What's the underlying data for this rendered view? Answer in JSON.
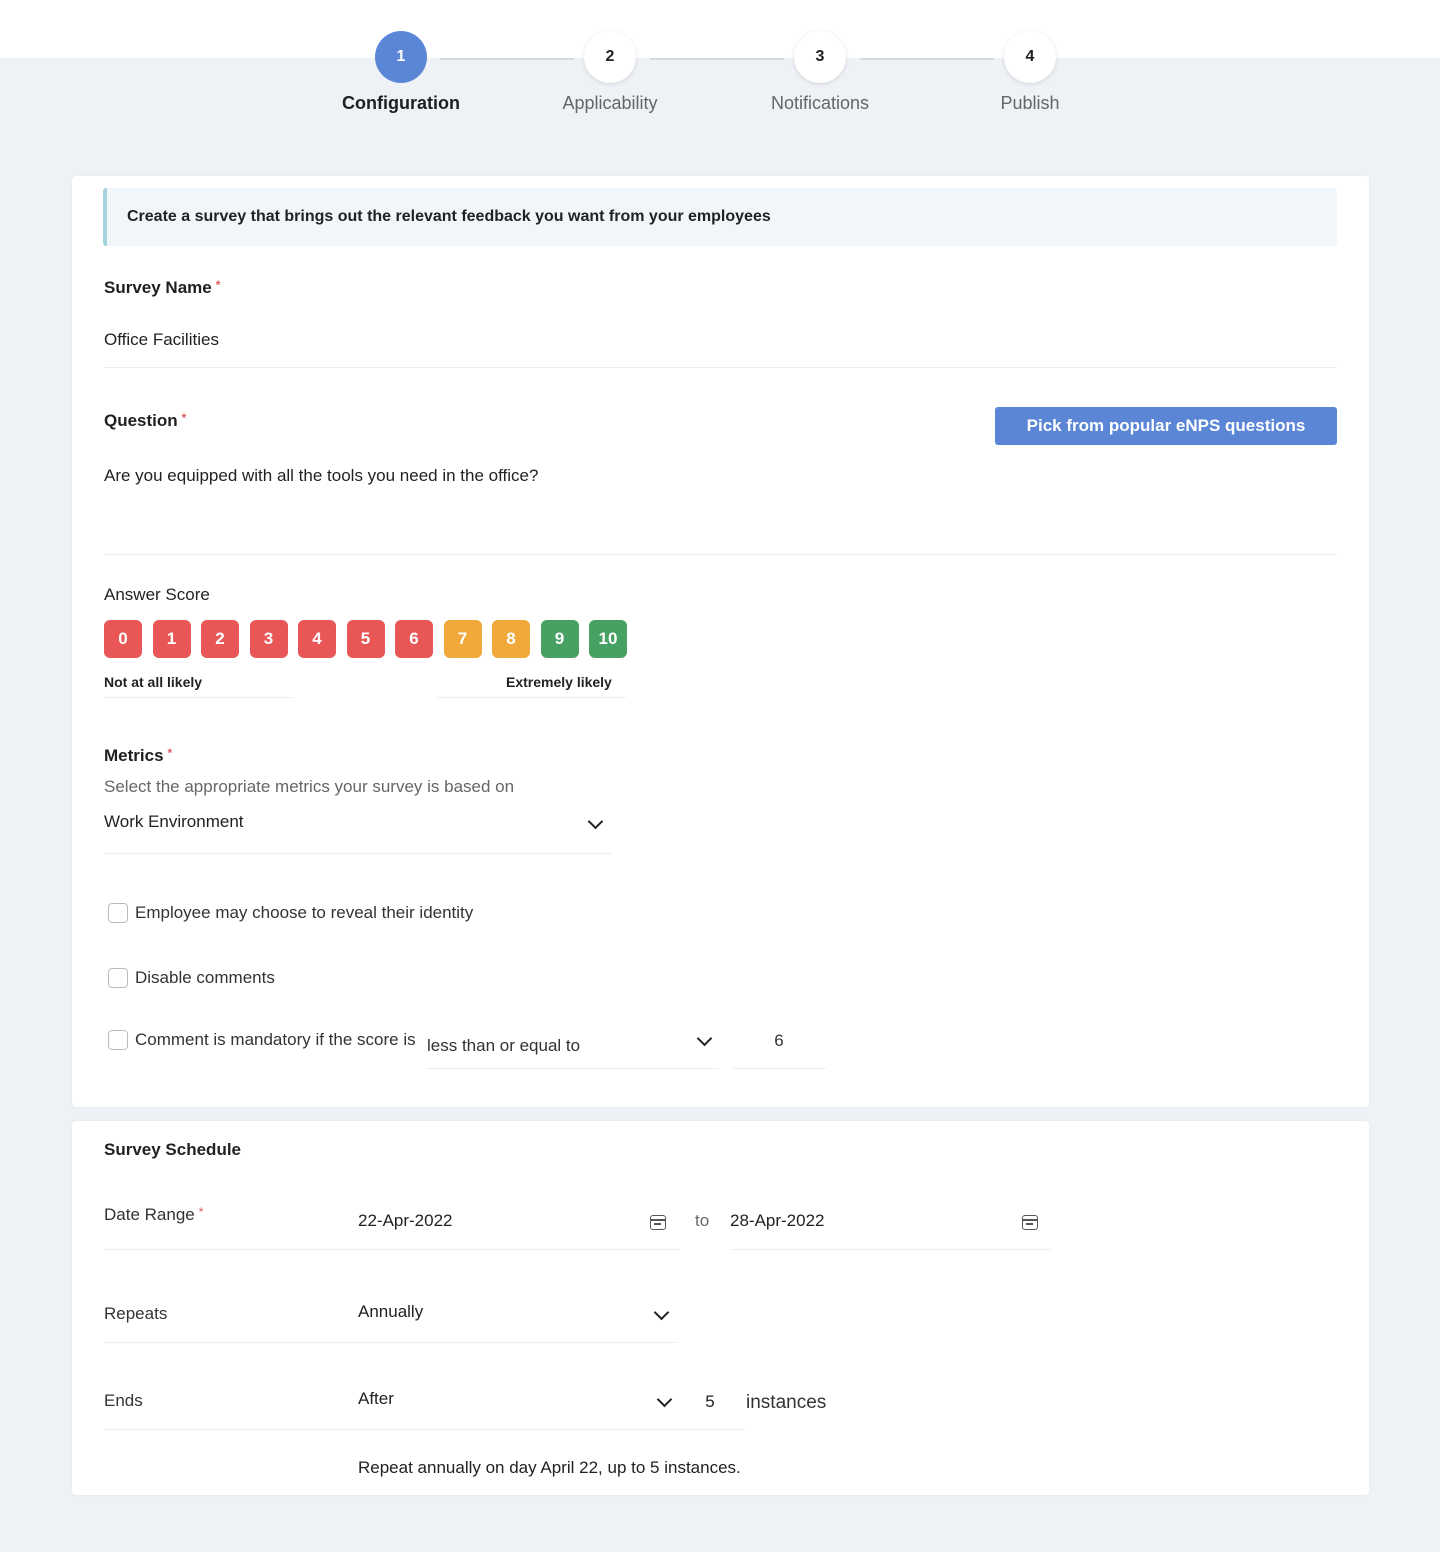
{
  "stepper": {
    "steps": [
      {
        "number": "1",
        "label": "Configuration",
        "active": true
      },
      {
        "number": "2",
        "label": "Applicability",
        "active": false
      },
      {
        "number": "3",
        "label": "Notifications",
        "active": false
      },
      {
        "number": "4",
        "label": "Publish",
        "active": false
      }
    ]
  },
  "config": {
    "banner": "Create a survey that brings out the relevant feedback you want from your employees",
    "survey_name": {
      "label": "Survey Name",
      "required_mark": "*",
      "value": "Office Facilities"
    },
    "question": {
      "label": "Question",
      "required_mark": "*",
      "value": "Are you equipped with all the tools you need in the office?",
      "pick_button": "Pick from popular eNPS questions"
    },
    "answer_score": {
      "label": "Answer Score",
      "scores": [
        {
          "value": "0",
          "category": "detractor"
        },
        {
          "value": "1",
          "category": "detractor"
        },
        {
          "value": "2",
          "category": "detractor"
        },
        {
          "value": "3",
          "category": "detractor"
        },
        {
          "value": "4",
          "category": "detractor"
        },
        {
          "value": "5",
          "category": "detractor"
        },
        {
          "value": "6",
          "category": "detractor"
        },
        {
          "value": "7",
          "category": "passive"
        },
        {
          "value": "8",
          "category": "passive"
        },
        {
          "value": "9",
          "category": "promoter"
        },
        {
          "value": "10",
          "category": "promoter"
        }
      ],
      "low_caption": "Not at all likely",
      "high_caption": "Extremely likely",
      "colors": {
        "detractor": "#e85656",
        "passive": "#f0a93a",
        "promoter": "#47a162"
      }
    },
    "metrics": {
      "label": "Metrics",
      "required_mark": "*",
      "helper": "Select the appropriate metrics your survey is based on",
      "selected": "Work Environment"
    },
    "options": {
      "reveal_identity": {
        "label": "Employee may choose to reveal their identity",
        "checked": false
      },
      "disable_comments": {
        "label": "Disable comments",
        "checked": false
      },
      "mandatory_comment": {
        "label": "Comment is mandatory if the score is",
        "checked": false,
        "operator": "less than or equal to",
        "threshold": "6"
      }
    }
  },
  "schedule": {
    "title": "Survey Schedule",
    "date_range": {
      "label": "Date Range",
      "required_mark": "*",
      "from": "22-Apr-2022",
      "separator": "to",
      "to": "28-Apr-2022"
    },
    "repeats": {
      "label": "Repeats",
      "value": "Annually"
    },
    "ends": {
      "label": "Ends",
      "value": "After",
      "count": "5",
      "unit": "instances"
    },
    "summary": "Repeat annually on day April 22, up to 5 instances."
  },
  "colors": {
    "accent": "#5b86d6",
    "required": "#e25a5a",
    "background": "#eef1f6"
  }
}
